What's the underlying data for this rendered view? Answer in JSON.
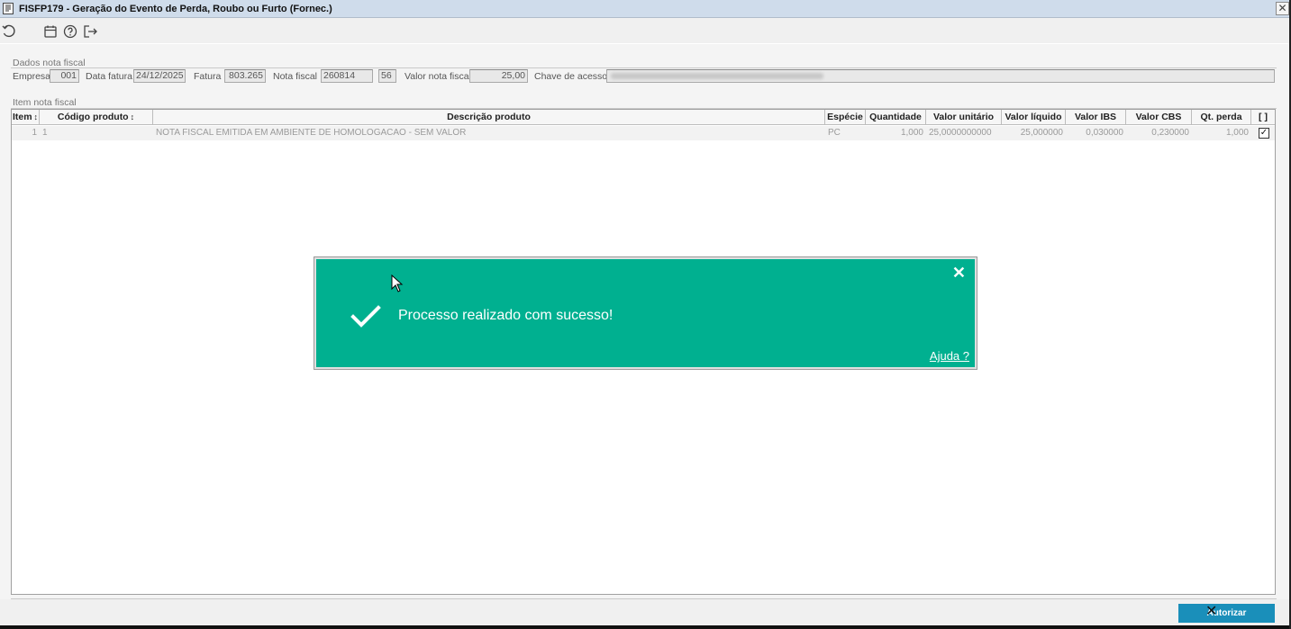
{
  "window": {
    "title": "FISFP179 - Geração do Evento de Perda, Roubo ou Furto (Fornec.)",
    "close_glyph": "✕"
  },
  "toolbar": {
    "icons": [
      "refresh-icon",
      "calendar-icon",
      "help-icon",
      "exit-icon"
    ]
  },
  "dados": {
    "section_title": "Dados nota fiscal",
    "empresa_label": "Empresa",
    "empresa_value": "001",
    "data_fatura_label": "Data fatura",
    "data_fatura_value": "24/12/2025",
    "fatura_label": "Fatura",
    "fatura_value": "803.265",
    "nota_fiscal_label": "Nota fiscal",
    "nota_fiscal_value": "260814",
    "serie_value": "56",
    "valor_label": "Valor nota fiscal",
    "valor_value": "25,00",
    "chave_label": "Chave de acesso",
    "chave_value": ""
  },
  "itens": {
    "section_title": "Item nota fiscal",
    "columns": [
      "Item",
      "Código produto",
      "Descrição produto",
      "Espécie",
      "Quantidade",
      "Valor unitário",
      "Valor líquido",
      "Valor IBS",
      "Valor CBS",
      "Qt. perda",
      "[ ]"
    ],
    "sort_glyph": "↕",
    "rows": [
      {
        "item": "1",
        "codigo": "1",
        "descricao": "NOTA FISCAL EMITIDA EM AMBIENTE DE HOMOLOGACAO - SEM VALOR",
        "especie": "PC",
        "quantidade": "1,000",
        "valor_unitario": "25,0000000000",
        "valor_liquido": "25,000000",
        "valor_ibs": "0,030000",
        "valor_cbs": "0,230000",
        "qt_perda": "1,000",
        "checked_glyph": "✓"
      }
    ]
  },
  "footer": {
    "autorizar_label": "Autorizar",
    "autorizar_overlay_glyph": "✕"
  },
  "toast": {
    "message": "Processo realizado com sucesso!",
    "help_link": "Ajuda ?",
    "close_glyph": "✕",
    "color": "#00b090"
  }
}
